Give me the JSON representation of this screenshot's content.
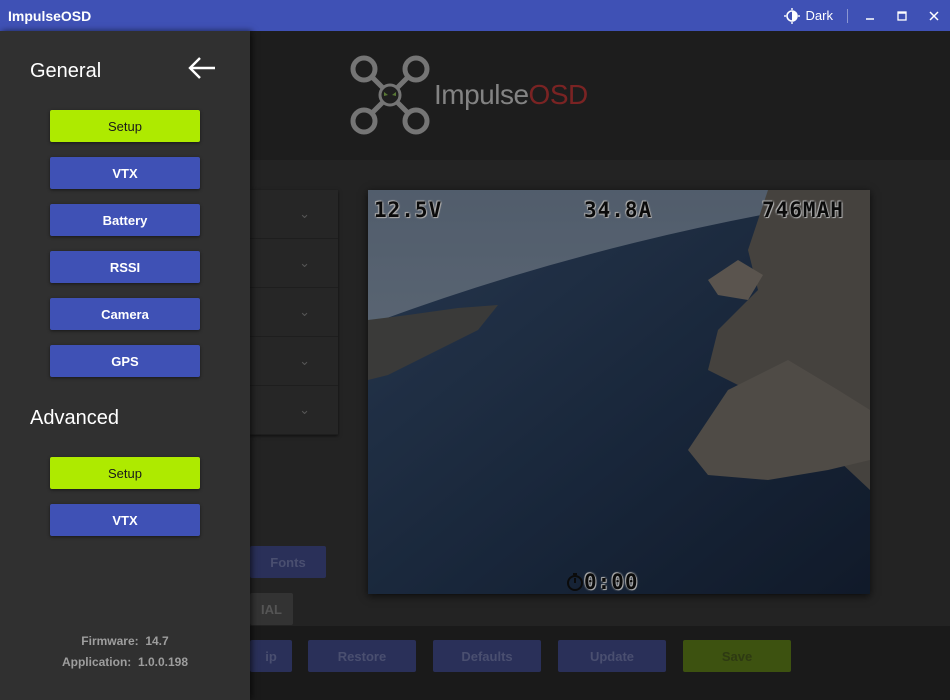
{
  "window": {
    "title": "ImpulseOSD",
    "theme_label": "Dark"
  },
  "logo": {
    "text_main": "Impulse",
    "text_accent": "OSD"
  },
  "drawer": {
    "general_title": "General",
    "general_items": [
      {
        "label": "Setup",
        "active": true
      },
      {
        "label": "VTX",
        "active": false
      },
      {
        "label": "Battery",
        "active": false
      },
      {
        "label": "RSSI",
        "active": false
      },
      {
        "label": "Camera",
        "active": false
      },
      {
        "label": "GPS",
        "active": false
      }
    ],
    "advanced_title": "Advanced",
    "advanced_items": [
      {
        "label": "Setup",
        "active": true
      },
      {
        "label": "VTX",
        "active": false
      }
    ],
    "firmware_label": "Firmware:",
    "firmware_value": "14.7",
    "application_label": "Application:",
    "application_value": "1.0.0.198"
  },
  "background": {
    "fonts_button": "Fonts",
    "ial_button": "IAL",
    "footer_buttons": [
      "ip",
      "Restore",
      "Defaults",
      "Update",
      "Save"
    ]
  },
  "osd": {
    "voltage": "12.5V",
    "current": "34.8A",
    "capacity": "746MAH",
    "timer": "0:00"
  },
  "colors": {
    "primary": "#3f51b5",
    "accent": "#aeea00",
    "drawer_bg": "#303030"
  }
}
